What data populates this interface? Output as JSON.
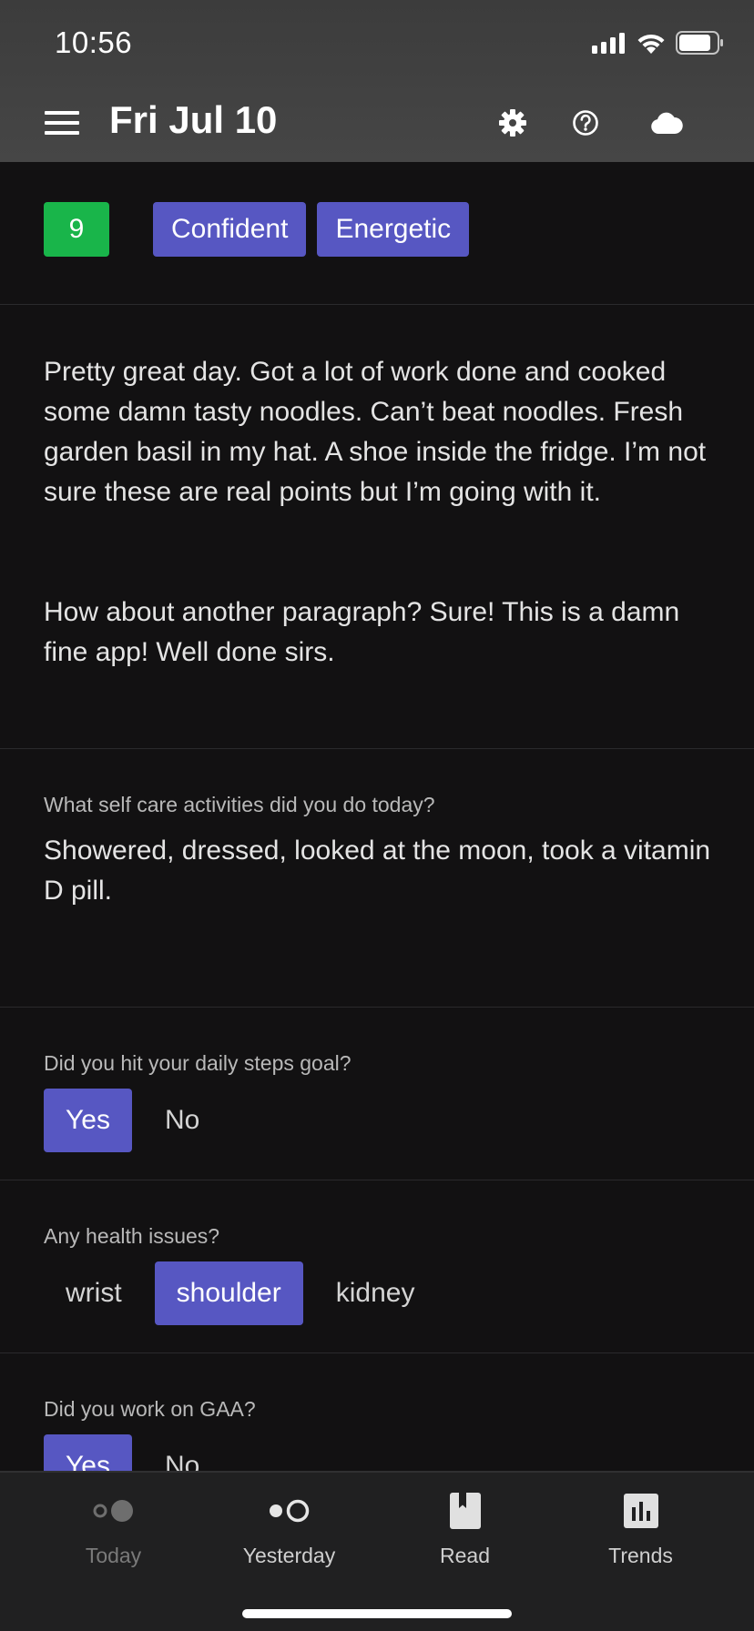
{
  "status_bar": {
    "time": "10:56"
  },
  "header": {
    "title": "Fri Jul 10",
    "icons": [
      "menu-icon",
      "gear-icon",
      "help-icon",
      "cloud-icon"
    ]
  },
  "tags": {
    "rating": "9",
    "moods": [
      "Confident",
      "Energetic"
    ]
  },
  "entry": {
    "paragraphs": [
      "Pretty great day. Got a lot of work done and cooked some damn tasty noodles. Can’t beat noodles. Fresh garden basil in my hat. A shoe inside the fridge. I’m not sure these are real points but I’m going with it.",
      "How about another paragraph? Sure! This is a damn fine app! Well done sirs."
    ]
  },
  "self_care": {
    "question": "What self care activities did you do today?",
    "answer": "Showered, dressed, looked at the moon, took a vitamin D pill."
  },
  "steps": {
    "question": "Did you hit your daily steps goal?",
    "options": [
      "Yes",
      "No"
    ],
    "selected": "Yes"
  },
  "health": {
    "question": "Any health issues?",
    "options": [
      "wrist",
      "shoulder",
      "kidney"
    ],
    "selected": "shoulder"
  },
  "gaa": {
    "question": "Did you work on GAA?",
    "options": [
      "Yes",
      "No"
    ],
    "selected": "Yes"
  },
  "tabbar": {
    "tabs": [
      {
        "label": "Today",
        "icon": "today-dots-icon",
        "active": true
      },
      {
        "label": "Yesterday",
        "icon": "yesterday-dots-icon",
        "active": false
      },
      {
        "label": "Read",
        "icon": "bookmark-icon",
        "active": false
      },
      {
        "label": "Trends",
        "icon": "bar-chart-icon",
        "active": false
      }
    ]
  },
  "colors": {
    "accent": "#5757c2",
    "rating_green": "#19b54a",
    "background": "#121112",
    "header": "#434343",
    "tabbar": "#202021"
  }
}
